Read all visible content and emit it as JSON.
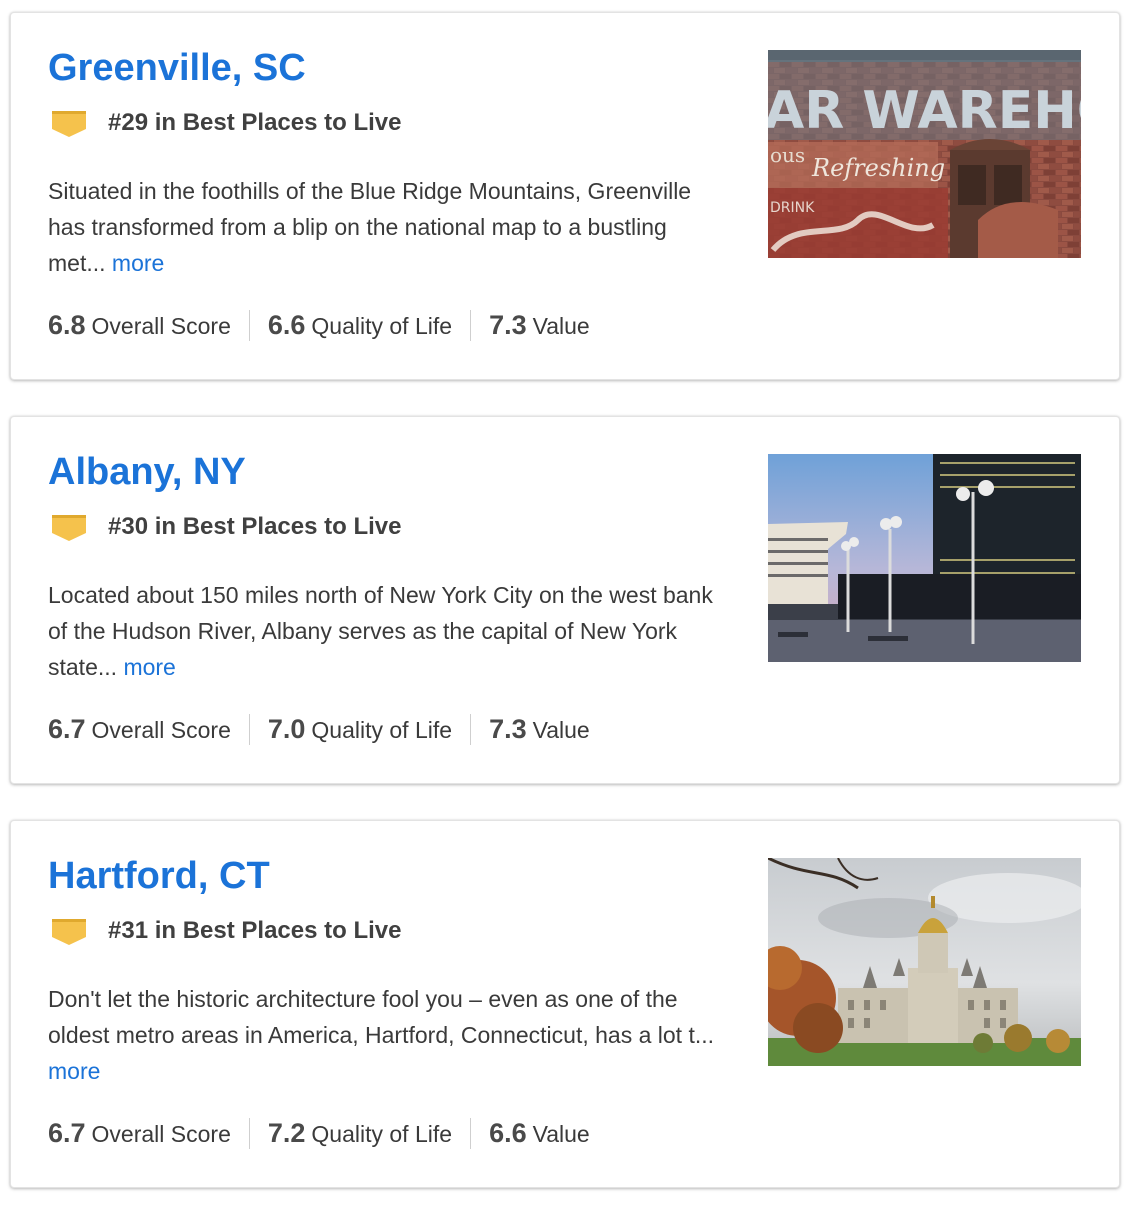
{
  "cities": [
    {
      "name": "Greenville, SC",
      "rank": "#29 in Best Places to Live",
      "description": "Situated in the foothills of the Blue Ridge Mountains, Greenville has transformed from a blip on the national map to a bustling met...",
      "more_label": "more",
      "scores": [
        {
          "value": "6.8",
          "label": "Overall Score"
        },
        {
          "value": "6.6",
          "label": "Quality of Life"
        },
        {
          "value": "7.3",
          "label": "Value"
        }
      ],
      "image": {
        "alt": "Painted brick warehouse wall",
        "sign_text": "AR WAREHOUSE",
        "sign_sub": "Refreshing",
        "sign_small": "ous",
        "sign_drink": "DRINK"
      }
    },
    {
      "name": "Albany, NY",
      "rank": "#30 in Best Places to Live",
      "description": "Located about 150 miles north of New York City on the west bank of the Hudson River, Albany serves as the capital of New York state...",
      "more_label": "more",
      "scores": [
        {
          "value": "6.7",
          "label": "Overall Score"
        },
        {
          "value": "7.0",
          "label": "Quality of Life"
        },
        {
          "value": "7.3",
          "label": "Value"
        }
      ],
      "image": {
        "alt": "Empire State Plaza at dusk"
      }
    },
    {
      "name": "Hartford, CT",
      "rank": "#31 in Best Places to Live",
      "description": "Don't let the historic architecture fool you – even as one of the oldest metro areas in America, Hartford, Connecticut, has a lot t...",
      "more_label": "more",
      "scores": [
        {
          "value": "6.7",
          "label": "Overall Score"
        },
        {
          "value": "7.2",
          "label": "Quality of Life"
        },
        {
          "value": "6.6",
          "label": "Value"
        }
      ],
      "image": {
        "alt": "Connecticut State Capitol with gold dome"
      }
    }
  ],
  "colors": {
    "link": "#1b73d8",
    "badge": "#f5c24c",
    "badge_shadow": "#e0a92e"
  }
}
